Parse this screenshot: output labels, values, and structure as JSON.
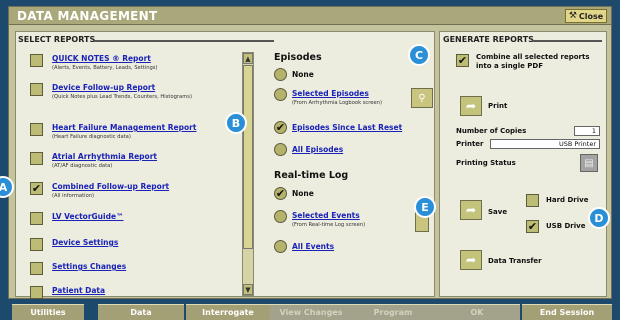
{
  "title": "DATA MANAGEMENT",
  "close_label": "Close",
  "select_reports": {
    "heading": "SELECT REPORTS",
    "items": [
      {
        "label": "QUICK NOTES ® Report",
        "sub": "(Alerts, Events, Battery, Leads, Settings)",
        "checked": false
      },
      {
        "label": "Device Follow-up Report",
        "sub": "(Quick Notes plus Lead Trends, Counters, Histograms)",
        "checked": false
      },
      {
        "label": "Heart Failure Management Report",
        "sub": "(Heart Failure diagnostic data)",
        "checked": false
      },
      {
        "label": "Atrial Arrhythmia Report",
        "sub": "(AT/AF diagnostic data)",
        "checked": false
      },
      {
        "label": "Combined Follow-up Report",
        "sub": "(All information)",
        "checked": true
      },
      {
        "label": "LV VectorGuide™",
        "sub": "",
        "checked": false
      },
      {
        "label": "Device Settings",
        "sub": "",
        "checked": false
      },
      {
        "label": "Settings Changes",
        "sub": "",
        "checked": false
      },
      {
        "label": "Patient Data",
        "sub": "",
        "checked": false
      }
    ]
  },
  "episodes": {
    "heading": "Episodes",
    "none_label": "None",
    "selected_label": "Selected Episodes",
    "selected_sub": "(From Arrhythmia Logbook screen)",
    "since_reset_label": "Episodes Since Last Reset",
    "all_label": "All Episodes",
    "selected_option": "since_reset"
  },
  "realtime": {
    "heading": "Real-time Log",
    "none_label": "None",
    "selected_label": "Selected Events",
    "selected_sub": "(From Real-time Log screen)",
    "all_label": "All Events",
    "selected_option": "none"
  },
  "generate": {
    "heading": "GENERATE REPORTS",
    "combine_label_1": "Combine all selected reports",
    "combine_label_2": "into a single PDF",
    "combine_checked": true,
    "print_label": "Print",
    "copies_label": "Number of Copies",
    "copies_value": "1",
    "printer_label": "Printer",
    "printer_value": "USB Printer",
    "status_label": "Printing Status",
    "save_label": "Save",
    "hard_drive_label": "Hard Drive",
    "hard_drive_checked": false,
    "usb_label": "USB Drive",
    "usb_checked": true,
    "transfer_label": "Data Transfer"
  },
  "callouts": {
    "a": "A",
    "b": "B",
    "c": "C",
    "d": "D",
    "e": "E"
  },
  "footer": [
    {
      "label": "Utilities",
      "enabled": true
    },
    {
      "label": "Data",
      "enabled": true
    },
    {
      "label": "Interrogate",
      "enabled": true
    },
    {
      "label": "View Changes",
      "enabled": false
    },
    {
      "label": "Program",
      "enabled": false
    },
    {
      "label": "OK",
      "enabled": false
    },
    {
      "label": "End Session",
      "enabled": true
    }
  ],
  "icons": {
    "check": "checkmark-icon",
    "print": "print-arrow-icon",
    "save": "save-arrow-icon",
    "transfer": "transfer-arrow-icon"
  },
  "colors": {
    "accent": "#2b8fd8",
    "link": "#1a22b8",
    "window_bg": "#c4c39c"
  }
}
